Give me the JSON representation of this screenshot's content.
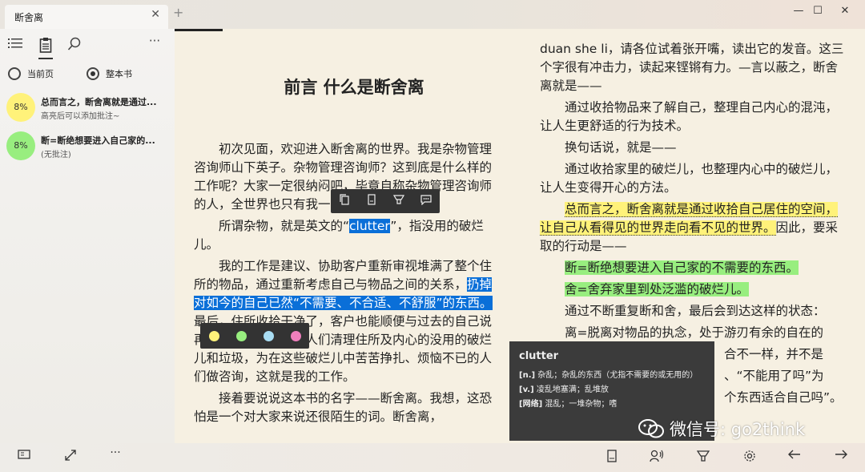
{
  "window": {
    "tab_title": "断舍离",
    "new_tab": "+",
    "close_tab": "✕",
    "minimize": "—",
    "maximize": "☐",
    "close": "✕"
  },
  "sidebar": {
    "more": "···",
    "scope": {
      "current_page": "当前页",
      "whole_book": "整本书",
      "selected": "whole_book"
    },
    "notes": [
      {
        "percent": "8%",
        "color": "#fff27a",
        "title": "总而言之，断舍离就是通过...",
        "subtitle": "高亮后可以添加批注~"
      },
      {
        "percent": "8%",
        "color": "#98ee7f",
        "title": "断=断绝想要进入自己家的...",
        "subtitle": "(无批注)"
      }
    ]
  },
  "left_page": {
    "chapter_title": "前言 什么是断舍离",
    "p1": "初次见面，欢迎进入断舍离的世界。我是杂物管理咨询师山下英子。杂物管理咨询师？这到底是什么样的工作呢？大家一定很纳闷吧，毕竟自称杂物管理咨询师的人，全世界也只有我一个。",
    "p2_a": "所谓杂物，就是英文的“",
    "p2_word": "clutter",
    "p2_b": "”，指没用的破烂儿。",
    "p3_a": "我的工作是建议、协助客户重新审视堆满了整个住所的物品，通过重新考虑自己与物品之间的关系，",
    "p3_sel": "扔掉对如今的自己已然“不需要、不合适、不舒服”的东西。",
    "p3_b": "最后，住所收拾干净了，客户也能顺便与过去的自己说再见了。没错，帮助人们清理住所及内心的没用的破烂儿和垃圾，为在这些破烂儿中苦苦挣扎、烦恼不已的人们做咨询，这就是我的工作。",
    "p4": "接着要说说这本书的名字——断舍离。我想，这恐怕是一个对大家来说还很陌生的词。断舍离，"
  },
  "right_page": {
    "p1": "duan she li，请各位试着张开嘴，读出它的发音。这三个字很有冲击力，读起来铿锵有力。—言以蔽之，断舍离就是——",
    "p2": "通过收拾物品来了解自己，整理自己内心的混沌，让人生更舒适的行为技术。",
    "p3": "换句话说，就是——",
    "p4": "通过收拾家里的破烂儿，也整理内心中的破烂儿，让人生变得开心的方法。",
    "p5_hl": "总而言之，断舍离就是通过收拾自己居住的空间，让自己从看得见的世界走向看不见的世界。",
    "p5_rest": "因此，要采取的行动是——",
    "p6_hl": "断=断绝想要进入自己家的不需要的东西。",
    "p7_hl": "舍=舍弃家里到处泛滥的破烂儿。",
    "p8": "通过不断重复断和舍，最后会到达这样的状态：",
    "p9": "离=脱离对物品的执念，处于游刃有余的自在的",
    "frag1": "合不一样，并不是",
    "frag2": "、“不能用了吗”为",
    "frag3": "个东西适合自己吗”。"
  },
  "dictionary": {
    "word": "clutter",
    "n": "[n.]",
    "n_def": "杂乱；杂乱的东西（尤指不需要的或无用的）",
    "v": "[v.]",
    "v_def": "凌乱地塞满；乱堆放",
    "web": "[网络]",
    "web_def": "混乱；一堆杂物；嗜"
  },
  "highlight_colors": [
    "#fff27a",
    "#98ee7f",
    "#a9ddf3",
    "#f07fbd"
  ],
  "reading_progress_fraction": 0.07,
  "bottom": {
    "more": "···"
  },
  "watermark": {
    "text": "微信号: go2think"
  }
}
